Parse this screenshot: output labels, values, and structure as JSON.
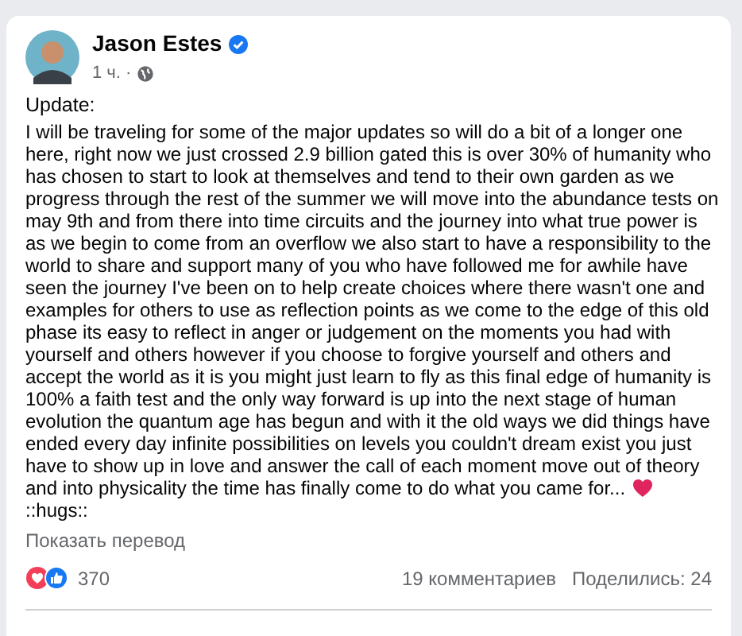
{
  "post": {
    "author": "Jason Estes",
    "verified": true,
    "time": "1 ч.",
    "separator": "·",
    "public": true,
    "title": "Update:",
    "body": "I will be traveling for some of the major updates so will do a bit of a longer one here, right now we just crossed 2.9 billion gated this is over 30% of humanity who has chosen to start to look at themselves and tend to their own garden as we progress through the rest of the summer we will move into the abundance tests on may 9th and from there into time circuits and the journey into what true power is as we begin to come from an overflow we also start to have a responsibility to the world to share and support many of you who have followed me for awhile have seen the journey I've been on to help create choices where there wasn't one and examples for others to use as reflection points as we come to the edge of this old phase its easy to reflect in anger or judgement on the moments you had with yourself and others however if you choose to forgive yourself and others and accept the world as it is you might just learn to fly as this final edge of humanity is 100% a faith test and the only way forward is up into the next stage of human evolution the quantum age has begun and with it the old ways we did things have ended every day infinite possibilities on levels you couldn't dream exist you just have to show up in love and answer the call of each moment move out of theory",
    "body_end": "and into physicality the time has finally come to do what you came for...",
    "signoff": "::hugs::",
    "translate_link": "Показать перевод",
    "reaction_count": "370",
    "comments": "19 комментариев",
    "shares": "Поделились: 24"
  }
}
